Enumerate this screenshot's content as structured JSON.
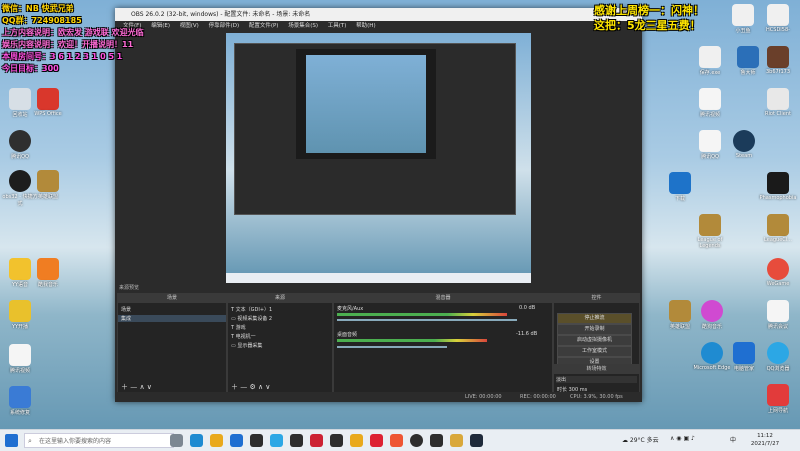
{
  "overlay": {
    "left_lines": [
      "微信：NB   快武兄弟",
      "QQ群：724908185",
      "上方内容说明：欧宏发 游戏联 欢迎光临",
      "娱乐内容说明：欢迎！开播说明！11",
      "本周房间号：3 6 1 2 3 1 0 5 1",
      "今日目标：300"
    ],
    "right_lines": [
      "感谢上周榜一：闪神！",
      "这把：5龙三星五费！"
    ]
  },
  "obs": {
    "title": "OBS 26.0.2 (32-bit, windows) - 配置文件: 未命名 - 场景: 未命名",
    "menu": [
      "文件(F)",
      "编辑(E)",
      "视图(V)",
      "停靠部件(D)",
      "配置文件(P)",
      "场景集合(S)",
      "工具(T)",
      "帮助(H)"
    ],
    "scenes_panel_title": "来源预览",
    "scenes_header": "场景",
    "scenes": [
      "场景",
      "集成"
    ],
    "sources_header": "来源",
    "sources": [
      "文本（GDI+）1",
      "视频采集设备 2",
      "游戏",
      "电视机一",
      "显示器采集"
    ],
    "mixer_header": "混音器",
    "mixer": [
      {
        "name": "麦克风/Aux",
        "db": "0.0 dB"
      },
      {
        "name": "桌面音频",
        "db": "-11.6 dB"
      }
    ],
    "transition_header": "转场特效",
    "transition_name": "淡出",
    "duration_label": "时长",
    "duration_value": "300 ms",
    "controls_header": "控件",
    "controls": [
      "停止推流",
      "开始录制",
      "启动虚拟摄像机",
      "工作室模式",
      "设置",
      "退出"
    ],
    "status": {
      "live": "LIVE: 00:00:00",
      "rec": "REC: 00:00:00",
      "cpu": "CPU: 3.9%, 30.00 fps"
    }
  },
  "desktop_icons_left": [
    "回收站",
    "WPS Office",
    "腾讯QQ",
    "obs32 - 快捷方式",
    "YY语音",
    "YY开播",
    "英雄联盟",
    "酷我音乐",
    "腾讯视频",
    "系统修复"
  ],
  "desktop_icons_right": [
    "小丑鱼",
    "HCSDI58-",
    "3b67f173",
    "鲁大师",
    "保存.exe",
    "腾讯视频",
    "腾讯QQ",
    "Steam",
    "Riot Client",
    "英雄联盟",
    "Phasmophobia",
    "League of Legends",
    "LeagueCl...",
    "下载",
    "WeGame",
    "酷狗音乐",
    "腾讯会议",
    "Microsoft Edge",
    "QQ浏览器",
    "电脑管家",
    "上网导航"
  ],
  "taskbar": {
    "search_placeholder": "在这里输入你要搜索的内容",
    "weather": "29°C 多云",
    "input_method": "中",
    "time": "11:12",
    "date": "2021/7/27"
  }
}
